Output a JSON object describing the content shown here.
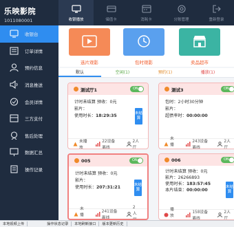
{
  "brand": {
    "name": "乐映影院",
    "code": "1011080001"
  },
  "nav": [
    {
      "label": "收银播放",
      "icon": "monitor-icon",
      "active": true
    },
    {
      "label": "储值卡",
      "icon": "card-icon"
    },
    {
      "label": "消耗卡",
      "icon": "calendar-card-icon"
    },
    {
      "label": "分账管理",
      "icon": "gear-icon"
    },
    {
      "label": "重新登录",
      "icon": "logout-icon"
    }
  ],
  "sidebar": [
    {
      "label": "收银台",
      "icon": "cashier-icon",
      "active": true
    },
    {
      "label": "订单详情",
      "icon": "order-icon"
    },
    {
      "label": "预约信息",
      "icon": "user-icon"
    },
    {
      "label": "消息推送",
      "icon": "speaker-icon"
    },
    {
      "label": "会员详情",
      "icon": "member-icon"
    },
    {
      "label": "三方支付",
      "icon": "payment-icon"
    },
    {
      "label": "售后处理",
      "icon": "service-icon"
    },
    {
      "label": "数据汇总",
      "icon": "chart-icon"
    },
    {
      "label": "操作记录",
      "icon": "record-icon"
    }
  ],
  "quick": [
    {
      "label": "选片观影",
      "color": "#f58a57"
    },
    {
      "label": "包时观影",
      "color": "#5aa0ee"
    },
    {
      "label": "卖品超市",
      "color": "#3bb4a3"
    }
  ],
  "tabs": [
    "默认",
    "空闲(1)",
    "预约(1)",
    "播放(1)"
  ],
  "rooms": [
    {
      "title": "测试厅1",
      "toggle": "ON",
      "lines": [
        {
          "k": "计时未结算",
          "v": " 预收：0元"
        },
        {
          "k": "影片：",
          "v": ""
        },
        {
          "k": "使用时长：",
          "v": "18:29:35",
          "bold": true
        }
      ],
      "badge": "未结算",
      "foot": [
        "未播放",
        "22设备离线",
        "2人厅"
      ]
    },
    {
      "title": "测试3",
      "toggle": "ON",
      "lines": [
        {
          "k": "包时：2小时30分钟",
          "v": ""
        },
        {
          "k": "影片：",
          "v": ""
        },
        {
          "k": "超债率时：",
          "v": "00:00:00",
          "bold": true
        }
      ],
      "badge": "",
      "foot": [
        "未播放",
        "243设备离线",
        "2人厅"
      ]
    },
    {
      "title": "005",
      "toggle": "ON",
      "lines": [
        {
          "k": "计时未结算",
          "v": " 预收：0元"
        },
        {
          "k": "影片：",
          "v": ""
        },
        {
          "k": "使用时长：",
          "v": "207:31:21",
          "bold": true
        }
      ],
      "badge": "未结算",
      "foot": [
        "未播放",
        "241设备离线",
        "2人厅"
      ]
    },
    {
      "title": "006",
      "toggle": "ON",
      "lines": [
        {
          "k": "计时未结算 预收：0元",
          "v": ""
        },
        {
          "k": "影片：",
          "v": "26266893"
        },
        {
          "k": "使用时长：",
          "v": "183:57:45",
          "bold": true
        },
        {
          "k": "本片结束：",
          "v": "00:00:00",
          "bold": true
        }
      ],
      "badge": "未结算",
      "foot": [
        "播放中",
        "158设备离线",
        "2人厅"
      ]
    }
  ],
  "status": [
    "本地视频上传",
    "",
    "操作状态记录",
    "本地刷新接口",
    "版本更新历史"
  ]
}
